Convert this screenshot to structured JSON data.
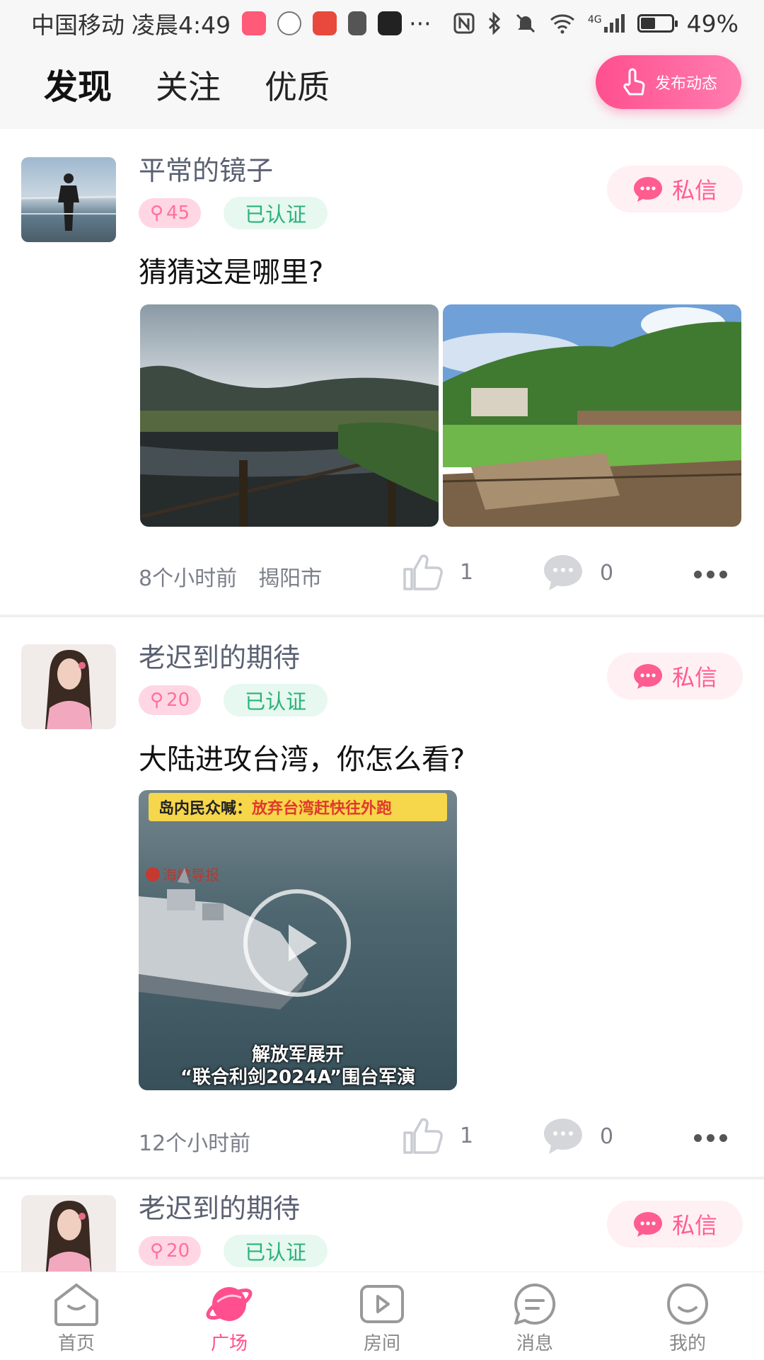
{
  "status_bar": {
    "carrier": "中国移动",
    "time": "凌晨4:49",
    "ellipsis": "···",
    "network": "4G",
    "battery_percent": 49,
    "battery_text": "49%"
  },
  "header": {
    "tabs": [
      {
        "label": "发现",
        "active": true
      },
      {
        "label": "关注",
        "active": false
      },
      {
        "label": "优质",
        "active": false
      }
    ],
    "publish_label": "发布动态"
  },
  "colors": {
    "accent_pink": "#ff4f8e",
    "verified_green": "#2bb27a",
    "nickname_gray": "#5a6172"
  },
  "posts": [
    {
      "nickname": "平常的镜子",
      "level": "45",
      "verified_label": "已认证",
      "dm_label": "私信",
      "text": "猜猜这是哪里?",
      "media_type": "photos",
      "time": "8个小时前",
      "location": "揭阳市",
      "likes": "1",
      "comments": "0"
    },
    {
      "nickname": "老迟到的期待",
      "level": "20",
      "verified_label": "已认证",
      "dm_label": "私信",
      "text": "大陆进攻台湾，你怎么看?",
      "media_type": "video",
      "video": {
        "top_label": "岛内民众喊：",
        "top_highlight": "放弃台湾赶快往外跑",
        "logo_text": "海峡导报",
        "caption_line1": "解放军展开",
        "caption_line2": "“联合利剑2024A”围台军演"
      },
      "time": "12个小时前",
      "likes": "1",
      "comments": "0"
    },
    {
      "nickname": "老迟到的期待",
      "level": "20",
      "verified_label": "已认证",
      "dm_label": "私信"
    }
  ],
  "bottom_nav": [
    {
      "label": "首页",
      "icon": "home-icon",
      "active": false
    },
    {
      "label": "广场",
      "icon": "planet-icon",
      "active": true
    },
    {
      "label": "房间",
      "icon": "video-room-icon",
      "active": false
    },
    {
      "label": "消息",
      "icon": "message-icon",
      "active": false
    },
    {
      "label": "我的",
      "icon": "smile-profile-icon",
      "active": false
    }
  ]
}
